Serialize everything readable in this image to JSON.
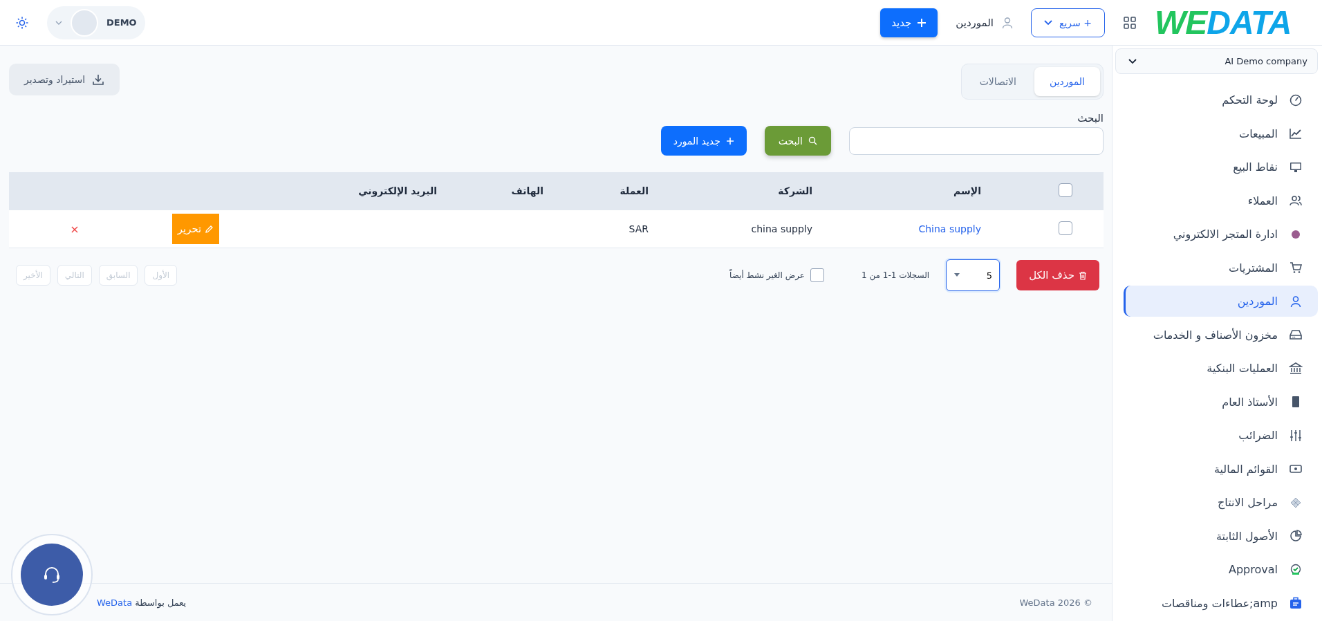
{
  "logo": {
    "accent": "WE",
    "rest": "DATA"
  },
  "topbar": {
    "quick_button": "+ سريع",
    "current_page": "الموردين",
    "new_button": "جديد",
    "user": "DEMO"
  },
  "company": "AI Demo company",
  "sidebar": {
    "items": [
      {
        "label": "لوحة التحكم",
        "selected": false
      },
      {
        "label": "المبيعات",
        "selected": false
      },
      {
        "label": "نقاط البيع",
        "selected": false
      },
      {
        "label": "العملاء",
        "selected": false
      },
      {
        "label": "ادارة المتجر الالكتروني",
        "selected": false
      },
      {
        "label": "المشتريات",
        "selected": false
      },
      {
        "label": "الموردين",
        "selected": true
      },
      {
        "label": "مخزون الأصناف و الخدمات",
        "selected": false
      },
      {
        "label": "العمليات البنكية",
        "selected": false
      },
      {
        "label": "الأستاذ العام",
        "selected": false
      },
      {
        "label": "الضرائب",
        "selected": false
      },
      {
        "label": "القوائم المالية",
        "selected": false
      },
      {
        "label": "مراحل الانتاج",
        "selected": false
      },
      {
        "label": "الأصول الثابتة",
        "selected": false
      },
      {
        "label": "Approval",
        "selected": false
      },
      {
        "label": "amp;عطاءات ومناقصات",
        "selected": false
      }
    ]
  },
  "tabs": [
    {
      "label": "الموردين",
      "selected": true
    },
    {
      "label": "الاتصالات",
      "selected": false
    }
  ],
  "import_export": "استيراد وتصدير",
  "search": {
    "label": "البحث",
    "button": "البحث"
  },
  "new_supplier": "جديد المورد",
  "table": {
    "select_all": {
      "checked": false
    },
    "columns": [
      "الإسم",
      "الشركة",
      "العملة",
      "الهاتف",
      "البريد الإلكتروني"
    ],
    "rows": [
      {
        "checked": false,
        "name": "China supply",
        "company": "china supply",
        "currency": "SAR",
        "edit": "تحرير",
        "delete": "×"
      }
    ]
  },
  "pagination": {
    "delete_all": "حذف الكل",
    "page_size": "5",
    "records": "السجلات 1-1 من 1",
    "show_inactive": {
      "label": "عرض الغير نشط أيضاً",
      "checked": false
    },
    "nav": [
      {
        "label": "الأول",
        "disabled": true
      },
      {
        "label": "السابق",
        "disabled": true
      },
      {
        "label": "التالي",
        "disabled": true
      },
      {
        "label": "الأخير",
        "disabled": true
      }
    ]
  },
  "footer": {
    "copyright": "© WeData 2026",
    "powered_by": "يعمل بواسطة",
    "powered_link": "WeData"
  }
}
